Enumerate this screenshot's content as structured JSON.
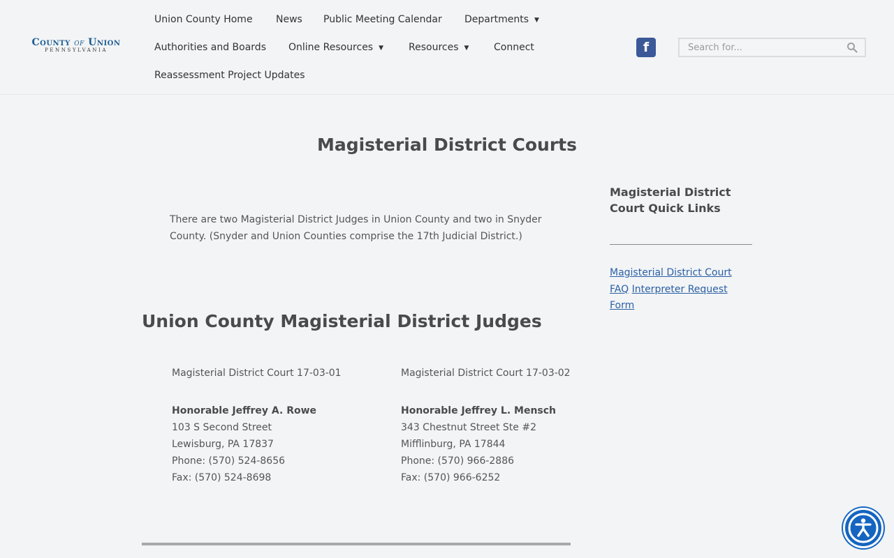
{
  "logo": {
    "main_left": "County",
    "main_of": "of",
    "main_right": "Union",
    "sub": "PENNSYLVANIA"
  },
  "nav": {
    "home": "Union County Home",
    "news": "News",
    "calendar": "Public Meeting Calendar",
    "departments": "Departments",
    "authorities": "Authorities and Boards",
    "online_resources": "Online Resources",
    "resources": "Resources",
    "connect": "Connect",
    "reassessment": "Reassessment Project Updates"
  },
  "social": {
    "facebook_glyph": "f"
  },
  "search": {
    "placeholder": "Search for..."
  },
  "page": {
    "title": "Magisterial District Courts",
    "intro": "There are two Magisterial District Judges in Union County and two in Snyder County. (Snyder and Union Counties comprise the 17th Judicial District.)",
    "section_title": "Union County Magisterial District Judges",
    "courts": [
      {
        "name": "Magisterial District Court 17-03-01",
        "judge": "Honorable Jeffrey A. Rowe",
        "street": "103 S Second Street",
        "city": "Lewisburg, PA 17837",
        "phone": "Phone: (570) 524-8656",
        "fax": "Fax: (570) 524-8698"
      },
      {
        "name": "Magisterial District Court 17-03-02",
        "judge": "Honorable Jeffrey L. Mensch",
        "street": "343 Chestnut Street Ste #2",
        "city": "Mifflinburg, PA 17844",
        "phone": "Phone: (570) 966-2886",
        "fax": "Fax: (570) 966-6252"
      }
    ]
  },
  "sidebar": {
    "title": "Magisterial District Court Quick Links",
    "links": [
      "Magisterial District Court FAQ",
      "Interpreter Request Form"
    ]
  },
  "colors": {
    "link": "#2b5fa5",
    "facebook": "#3b5998",
    "accessibility": "#1565c0",
    "logo": "#1c5d93"
  },
  "icons": {
    "search": "search-icon",
    "facebook": "facebook-icon",
    "accessibility": "accessibility-icon",
    "dropdown": "caret-down-icon"
  }
}
